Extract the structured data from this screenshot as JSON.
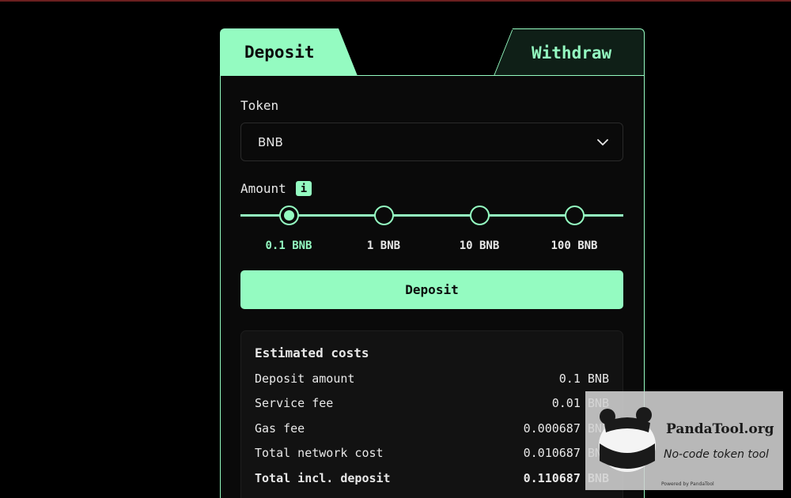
{
  "tabs": {
    "deposit": "Deposit",
    "withdraw": "Withdraw"
  },
  "form": {
    "token_label": "Token",
    "token_selected": "BNB",
    "amount_label": "Amount",
    "info_badge": "i",
    "amount_options": [
      "0.1 BNB",
      "1 BNB",
      "10 BNB",
      "100 BNB"
    ],
    "selected_amount": "0.1 BNB",
    "deposit_button": "Deposit"
  },
  "costs": {
    "title": "Estimated costs",
    "rows": [
      {
        "label": "Deposit amount",
        "value": "0.1 BNB"
      },
      {
        "label": "Service fee",
        "value": "0.01 BNB"
      },
      {
        "label": "Gas fee",
        "value": "0.000687 BNB"
      },
      {
        "label": "Total network cost",
        "value": "0.010687 BNB"
      },
      {
        "label": "Total incl. deposit",
        "value": "0.110687 BNB"
      }
    ]
  },
  "watermark": {
    "site": "PandaTool.org",
    "tagline": "No-code token tool",
    "powered": "Powered by PandaTool"
  },
  "colors": {
    "accent": "#94fbc1",
    "background": "#000000",
    "panel": "#0a0a0a"
  },
  "icons": {
    "select_chevron": "chevron-down-icon",
    "watermark_logo": "panda-icon"
  }
}
